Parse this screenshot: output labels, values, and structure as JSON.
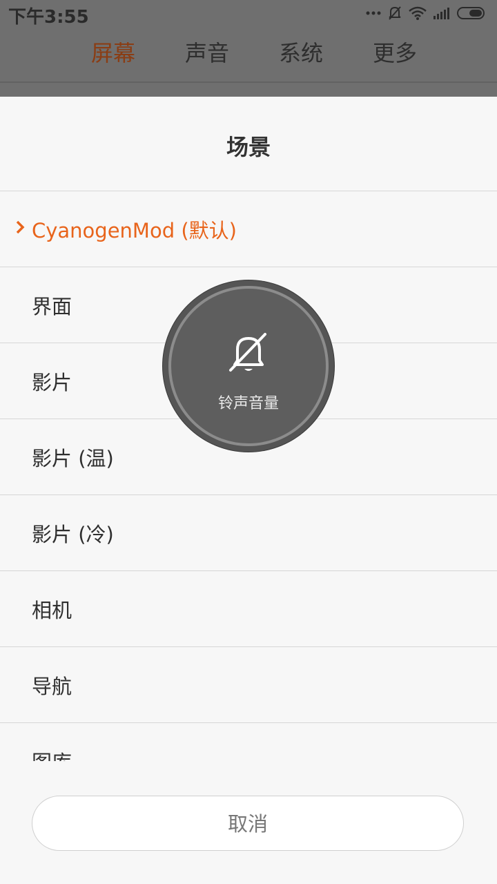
{
  "status": {
    "time": "下午3:55"
  },
  "tabs": [
    {
      "label": "屏幕"
    },
    {
      "label": "声音"
    },
    {
      "label": "系统"
    },
    {
      "label": "更多"
    }
  ],
  "sheet": {
    "title": "场景",
    "items": [
      {
        "label": "CyanogenMod (默认)",
        "selected": true
      },
      {
        "label": "界面"
      },
      {
        "label": "影片"
      },
      {
        "label": "影片 (温)"
      },
      {
        "label": "影片 (冷)"
      },
      {
        "label": "相机"
      },
      {
        "label": "导航"
      },
      {
        "label": "图库"
      }
    ],
    "cancel": "取消"
  },
  "overlay": {
    "label": "铃声音量",
    "icon": "bell-muted-icon"
  },
  "colors": {
    "accent": "#e8641b",
    "active_tab": "#8a3d14"
  }
}
